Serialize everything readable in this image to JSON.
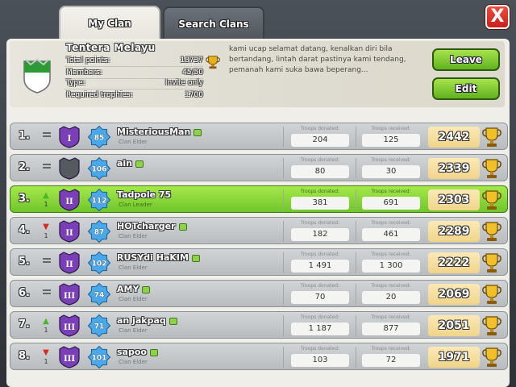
{
  "tabs": [
    {
      "label": "My Clan"
    },
    {
      "label": "Search Clans"
    }
  ],
  "close_label": "X",
  "clan": {
    "name": "Tentera Melayu",
    "stats": [
      {
        "label": "Total points:",
        "value": "18737"
      },
      {
        "label": "Members:",
        "value": "45/50"
      },
      {
        "label": "Type:",
        "value": "Invite only"
      },
      {
        "label": "Required trophies:",
        "value": "1700"
      }
    ],
    "description": "kami ucap selamat datang, kenalkan diri bila bertandang, lintah darat pastinya kami tendang, pemanah kami suka bawa beperang..."
  },
  "buttons": {
    "leave": "Leave",
    "edit": "Edit"
  },
  "column_labels": {
    "donated": "Troops donated:",
    "received": "Troops received:"
  },
  "colors": {
    "league_purple": "#7a3fb8",
    "league_gray": "#555a5e",
    "level_blue": "#4aa7e8",
    "highlight": "#8ed83c",
    "up_arrow": "#4cb52a",
    "down_arrow": "#d42a1f"
  },
  "members": [
    {
      "rank": "1.",
      "trend": "same",
      "trend_num": "",
      "league": "purple",
      "league_roman": "I",
      "level": "85",
      "name": "MisteriousMan",
      "role": "Clan Elder",
      "donated": "204",
      "received": "125",
      "trophies": "2442",
      "me": false
    },
    {
      "rank": "2.",
      "trend": "same",
      "trend_num": "",
      "league": "gray",
      "league_roman": "",
      "level": "106",
      "name": "ain",
      "role": "",
      "donated": "80",
      "received": "30",
      "trophies": "2339",
      "me": false
    },
    {
      "rank": "3.",
      "trend": "up",
      "trend_num": "1",
      "league": "purple",
      "league_roman": "II",
      "level": "112",
      "name": "Tadpole 75",
      "role": "Clan Leader",
      "donated": "381",
      "received": "691",
      "trophies": "2303",
      "me": true
    },
    {
      "rank": "4.",
      "trend": "down",
      "trend_num": "1",
      "league": "purple",
      "league_roman": "II",
      "level": "87",
      "name": "HOTcharger",
      "role": "Clan Elder",
      "donated": "182",
      "received": "461",
      "trophies": "2289",
      "me": false
    },
    {
      "rank": "5.",
      "trend": "same",
      "trend_num": "",
      "league": "purple",
      "league_roman": "II",
      "level": "102",
      "name": "RUSYdi HaKIM",
      "role": "Clan Elder",
      "donated": "1 491",
      "received": "1 300",
      "trophies": "2222",
      "me": false
    },
    {
      "rank": "6.",
      "trend": "same",
      "trend_num": "",
      "league": "purple",
      "league_roman": "III",
      "level": "74",
      "name": "AMY",
      "role": "Clan Elder",
      "donated": "70",
      "received": "20",
      "trophies": "2069",
      "me": false
    },
    {
      "rank": "7.",
      "trend": "up",
      "trend_num": "1",
      "league": "purple",
      "league_roman": "III",
      "level": "71",
      "name": "an jakpaq",
      "role": "Clan Elder",
      "donated": "1 187",
      "received": "877",
      "trophies": "2051",
      "me": false
    },
    {
      "rank": "8.",
      "trend": "down",
      "trend_num": "1",
      "league": "purple",
      "league_roman": "III",
      "level": "101",
      "name": "sapoo",
      "role": "Clan Elder",
      "donated": "103",
      "received": "72",
      "trophies": "1971",
      "me": false
    }
  ]
}
